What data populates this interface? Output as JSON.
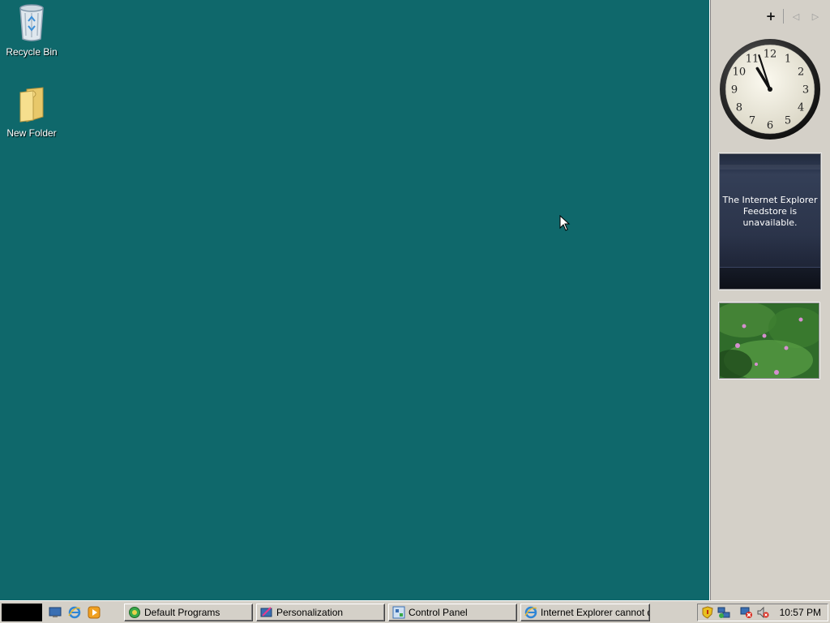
{
  "desktop": {
    "icons": [
      {
        "label": "Recycle Bin",
        "icon": "recycle-bin-icon"
      },
      {
        "label": "New Folder",
        "icon": "folder-icon"
      }
    ],
    "background_color": "#0f686b"
  },
  "sidebar": {
    "toolbar": {
      "add": "+",
      "prev": "◁",
      "next": "▷"
    },
    "clock": {
      "numerals": [
        "12",
        "1",
        "2",
        "3",
        "4",
        "5",
        "6",
        "7",
        "8",
        "9",
        "10",
        "11"
      ],
      "time": "10:57"
    },
    "feeds": {
      "message": "The Internet Explorer Feedstore is unavailable."
    },
    "slideshow": {
      "icon": "flowers-photo"
    }
  },
  "taskbar": {
    "quick_launch": [
      "show-desktop-icon",
      "internet-explorer-icon",
      "media-player-icon"
    ],
    "tasks": [
      {
        "label": "Default Programs",
        "icon": "default-programs-icon"
      },
      {
        "label": "Personalization",
        "icon": "personalization-icon"
      },
      {
        "label": "Control Panel",
        "icon": "control-panel-icon"
      },
      {
        "label": "Internet Explorer cannot d...",
        "icon": "internet-explorer-icon"
      }
    ],
    "tray": {
      "icons": [
        "security-shield-icon",
        "network-icon",
        "network-disconnected-icon",
        "volume-muted-icon"
      ],
      "time": "10:57 PM"
    }
  },
  "colors": {
    "desktop": "#0f686b",
    "taskbar": "#d4d0c8",
    "sidebar": "#d4d0c8"
  }
}
